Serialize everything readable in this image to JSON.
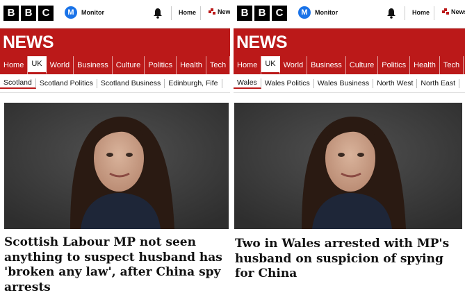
{
  "left": {
    "brand": {
      "logo_letters": [
        "B",
        "B",
        "C"
      ],
      "monitor_badge": "M",
      "monitor_label": "Monitor"
    },
    "topbar": {
      "home_label": "Home",
      "news_label": "News"
    },
    "section_title": "NEWS",
    "nav": [
      "Home",
      "UK",
      "World",
      "Business",
      "Culture",
      "Politics",
      "Health",
      "Tech"
    ],
    "nav_active": "UK",
    "subnav": [
      "Scotland",
      "Scotland Politics",
      "Scotland Business",
      "Edinburgh, Fife"
    ],
    "subnav_active": "Scotland",
    "headline": "Scottish Labour MP not seen anything to suspect husband has 'broken any law', after China spy arrests"
  },
  "right": {
    "brand": {
      "logo_letters": [
        "B",
        "B",
        "C"
      ],
      "monitor_badge": "M",
      "monitor_label": "Monitor"
    },
    "topbar": {
      "home_label": "Home",
      "news_label": "News"
    },
    "section_title": "NEWS",
    "nav": [
      "Home",
      "UK",
      "World",
      "Business",
      "Culture",
      "Politics",
      "Health",
      "Tech"
    ],
    "nav_active": "UK",
    "subnav": [
      "Wales",
      "Wales Politics",
      "Wales Business",
      "North West",
      "North East"
    ],
    "subnav_active": "Wales",
    "headline": "Two in Wales arrested with MP's husband on suspicion of spying for China"
  },
  "colors": {
    "bbc_red": "#bb1919",
    "monitor_blue": "#1a73e8"
  },
  "icons": [
    "bell-icon",
    "news-icon",
    "monitor-icon"
  ]
}
